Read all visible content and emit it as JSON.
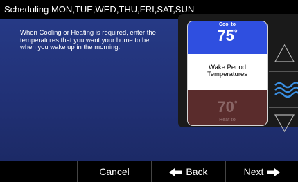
{
  "header": {
    "title": "Scheduling MON,TUE,WED,THU,FRI,SAT,SUN"
  },
  "instructions": "When Cooling or Heating is required, enter the temperatures that you want your home to be when you wake up in the morning.",
  "setpoints": {
    "cool_label": "Cool to",
    "cool_value": "75",
    "period_line1": "Wake Period",
    "period_line2": "Temperatures",
    "heat_value": "70",
    "heat_label": "Heat to",
    "degree_symbol": "°"
  },
  "footer": {
    "cancel": "Cancel",
    "back": "Back",
    "next": "Next"
  },
  "colors": {
    "cool": "#2f4fe0",
    "heat": "#5a2c2c",
    "fan_icon": "#3a8ee0"
  },
  "icons": {
    "up": "up-triangle-icon",
    "fan": "wave-icon",
    "down": "down-triangle-icon",
    "back": "left-arrow-icon",
    "next": "right-arrow-icon"
  }
}
